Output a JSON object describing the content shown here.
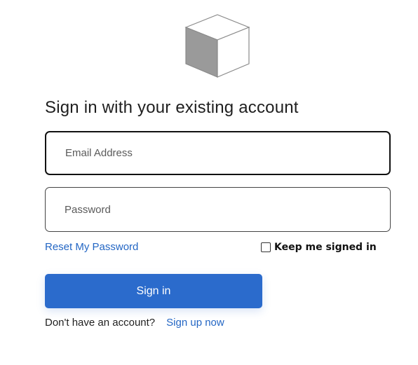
{
  "logo": {
    "icon": "cube-logo-icon"
  },
  "heading": "Sign in with your existing account",
  "fields": {
    "email": {
      "placeholder": "Email Address",
      "value": ""
    },
    "password": {
      "placeholder": "Password",
      "value": ""
    }
  },
  "links": {
    "reset_password": "Reset My Password",
    "signup_prompt": "Don't have an account?",
    "signup": "Sign up now"
  },
  "keep_signed_in": {
    "label": "Keep me signed in",
    "checked": false
  },
  "signin_button": "Sign in",
  "colors": {
    "accent": "#2b6bcc",
    "link": "#2366c4",
    "text": "#1f1f1f"
  }
}
